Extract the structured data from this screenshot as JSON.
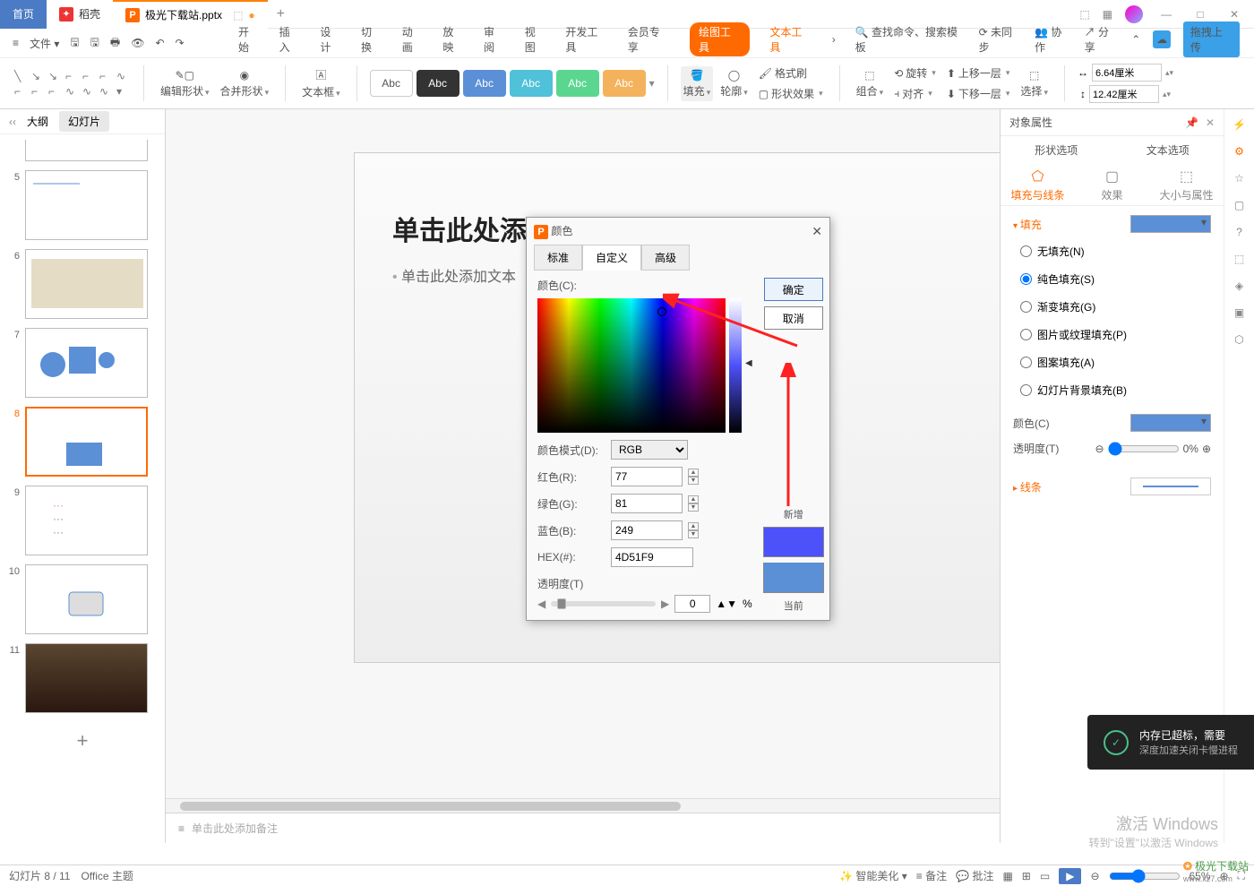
{
  "titleBar": {
    "homeTab": "首页",
    "dockerTab": "稻壳",
    "fileTab": "极光下载站.pptx",
    "addTab": "+"
  },
  "winControls": {
    "layout": "⬚",
    "grid": "▦",
    "min": "—",
    "max": "□",
    "close": "✕"
  },
  "qat": {
    "menu": "≡",
    "file": "文件",
    "dd": "▾"
  },
  "menuBar": {
    "items": [
      "开始",
      "插入",
      "设计",
      "切换",
      "动画",
      "放映",
      "审阅",
      "视图",
      "开发工具",
      "会员专享"
    ],
    "draw": "绘图工具",
    "text": "文本工具",
    "more": "›",
    "searchPlaceholder": "查找命令、搜索模板",
    "unsync": "未同步",
    "collab": "协作",
    "share": "分享",
    "upload": "拖拽上传"
  },
  "ribbon": {
    "editShape": "编辑形状",
    "mergeShape": "合并形状",
    "textbox": "文本框",
    "abc": "Abc",
    "fill": "填充",
    "outline": "轮廓",
    "effect": "形状效果",
    "fmtPaint": "格式刷",
    "combine": "组合",
    "rotate": "旋转",
    "align": "对齐",
    "up": "上移一层",
    "down": "下移一层",
    "select": "选择",
    "width": "6.64厘米",
    "height": "12.42厘米"
  },
  "outline": {
    "tab1": "大纲",
    "tab2": "幻灯片"
  },
  "thumbs": {
    "nums": [
      5,
      6,
      7,
      8,
      9,
      10,
      11
    ]
  },
  "slide": {
    "title": "单击此处添加标题",
    "body": "单击此处添加文本"
  },
  "notes": "单击此处添加备注",
  "propPane": {
    "header": "对象属性",
    "tabShape": "形状选项",
    "tabText": "文本选项",
    "subFill": "填充与线条",
    "subEffect": "效果",
    "subSize": "大小与属性",
    "sectionFill": "填充",
    "sectionLine": "线条",
    "noFill": "无填充(N)",
    "solidFill": "纯色填充(S)",
    "gradFill": "渐变填充(G)",
    "picFill": "图片或纹理填充(P)",
    "pattFill": "图案填充(A)",
    "bgFill": "幻灯片背景填充(B)",
    "colorLbl": "颜色(C)",
    "transLbl": "透明度(T)",
    "transVal": "0%"
  },
  "dialog": {
    "title": "颜色",
    "close": "✕",
    "tabStd": "标准",
    "tabCustom": "自定义",
    "tabAdv": "高级",
    "ok": "确定",
    "cancel": "取消",
    "colorLbl": "颜色(C):",
    "modeLbl": "颜色模式(D):",
    "mode": "RGB",
    "rLbl": "红色(R):",
    "gLbl": "绿色(G):",
    "bLbl": "蓝色(B):",
    "hexLbl": "HEX(#):",
    "r": "77",
    "g": "81",
    "b": "249",
    "hex": "4D51F9",
    "transLbl": "透明度(T)",
    "transVal": "0",
    "pct": "%",
    "newLbl": "新增",
    "curLbl": "当前"
  },
  "status": {
    "page": "幻灯片 8 / 11",
    "theme": "Office 主题",
    "beautify": "智能美化",
    "notes": "备注",
    "comment": "批注",
    "zoom": "65%"
  },
  "activate": {
    "l1": "激活 Windows",
    "l2": "转到\"设置\"以激活 Windows"
  },
  "notice": {
    "l1": "内存已超标，需要",
    "l2": "深度加速关闭卡慢进程"
  },
  "watermark": "极光下载站"
}
